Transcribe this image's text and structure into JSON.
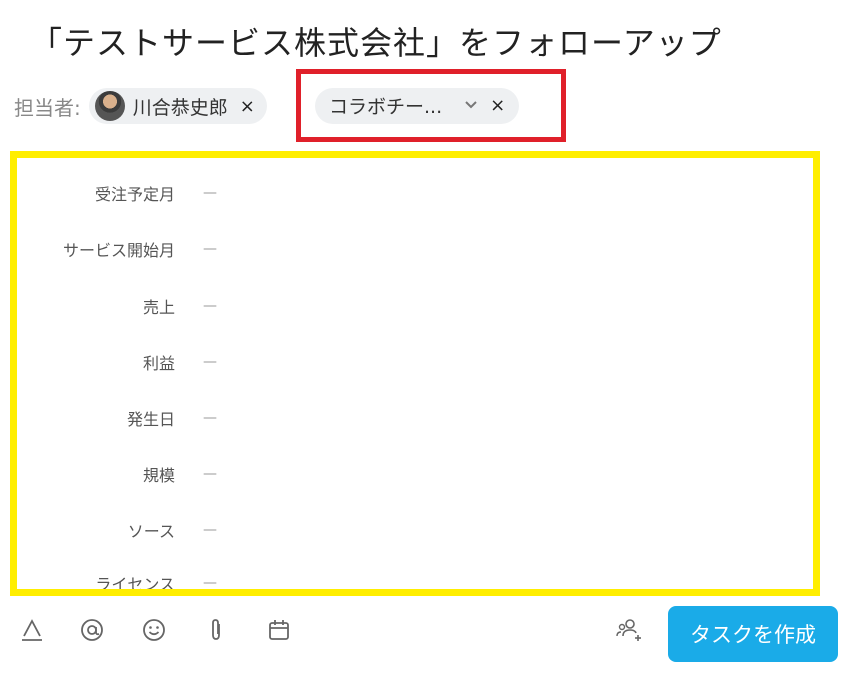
{
  "title": "「テストサービス株式会社」をフォローアップ",
  "assignee": {
    "label": "担当者:",
    "person_name": "川合恭史郎",
    "remove_symbol": "×"
  },
  "team": {
    "name": "コラボチー...",
    "chevron": "⌄",
    "remove_symbol": "×"
  },
  "fields": [
    {
      "label": "受注予定月",
      "value": "—"
    },
    {
      "label": "サービス開始月",
      "value": "—"
    },
    {
      "label": "売上",
      "value": "—"
    },
    {
      "label": "利益",
      "value": "—"
    },
    {
      "label": "発生日",
      "value": "—"
    },
    {
      "label": "規模",
      "value": "—"
    },
    {
      "label": "ソース",
      "value": "—"
    },
    {
      "label": "ライセンス",
      "value": "—"
    }
  ],
  "toolbar": {
    "icons": [
      "text-format-icon",
      "mention-icon",
      "emoji-icon",
      "attachment-icon",
      "calendar-icon",
      "add-collaborator-icon"
    ]
  },
  "create_button_label": "タスクを作成",
  "colors": {
    "highlight_red": "#e0202a",
    "highlight_yellow": "#ffee00",
    "primary_button": "#1aabe8"
  }
}
